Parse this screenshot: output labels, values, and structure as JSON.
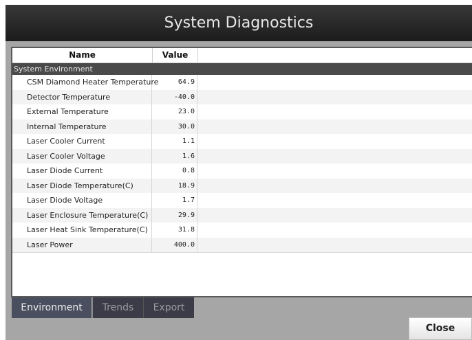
{
  "window": {
    "title": "System Diagnostics"
  },
  "grid": {
    "columns": {
      "name": "Name",
      "value": "Value"
    },
    "group": "System Environment",
    "rows": [
      {
        "name": "CSM Diamond Heater Temperature",
        "value": "64.9"
      },
      {
        "name": "Detector Temperature",
        "value": "-40.0"
      },
      {
        "name": "External Temperature",
        "value": "23.0"
      },
      {
        "name": "Internal Temperature",
        "value": "30.0"
      },
      {
        "name": "Laser Cooler Current",
        "value": "1.1"
      },
      {
        "name": "Laser Cooler Voltage",
        "value": "1.6"
      },
      {
        "name": "Laser Diode Current",
        "value": "0.8"
      },
      {
        "name": "Laser Diode Temperature(C)",
        "value": "18.9"
      },
      {
        "name": "Laser Diode Voltage",
        "value": "1.7"
      },
      {
        "name": "Laser Enclosure Temperature(C)",
        "value": "29.9"
      },
      {
        "name": "Laser Heat Sink Temperature(C)",
        "value": "31.8"
      },
      {
        "name": "Laser Power",
        "value": "400.0"
      }
    ]
  },
  "tabs": [
    {
      "label": "Environment",
      "active": true
    },
    {
      "label": "Trends",
      "active": false
    },
    {
      "label": "Export",
      "active": false
    }
  ],
  "buttons": {
    "close": "Close"
  }
}
